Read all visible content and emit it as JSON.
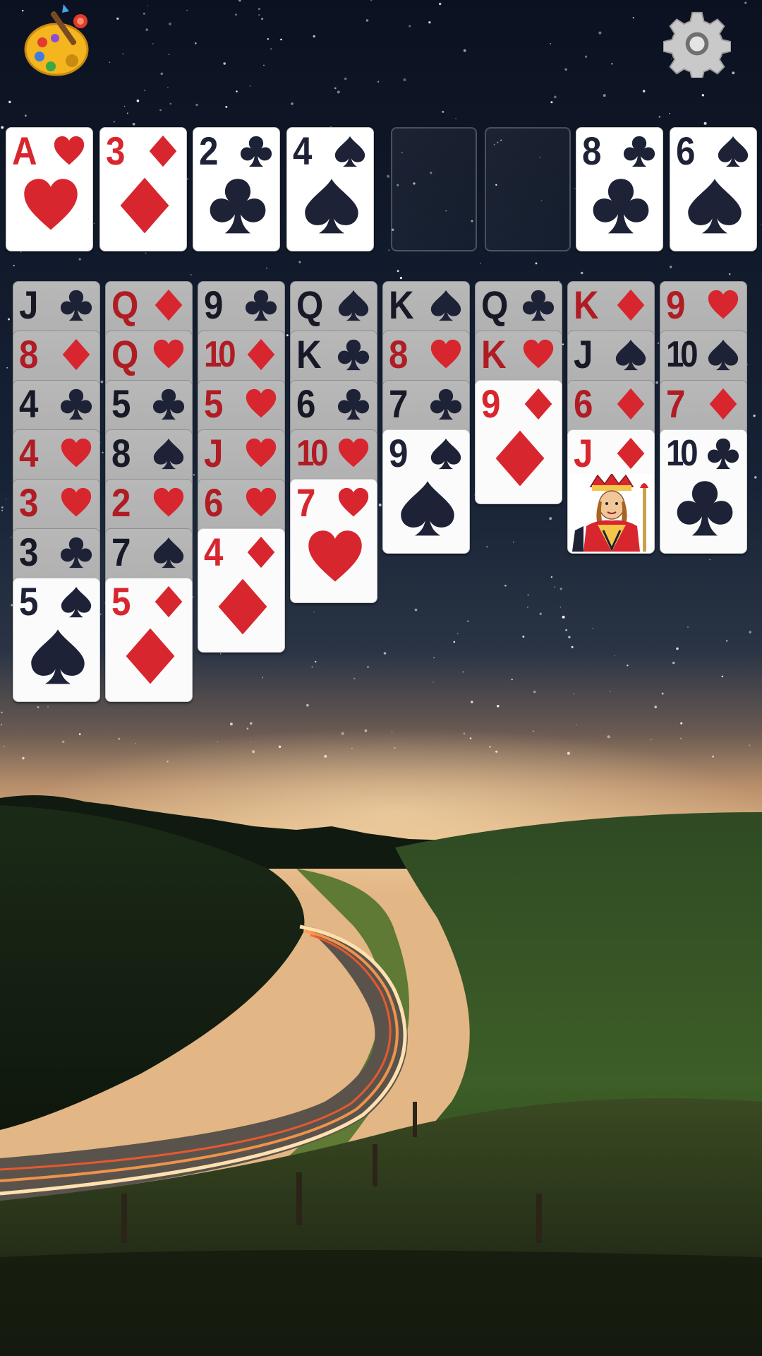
{
  "colors": {
    "red_suit": "#d8262f",
    "black_suit": "#1d2236",
    "card_face": "#ffffff",
    "covered_card": "#b0b0b0"
  },
  "toolbar": {
    "theme_icon": "palette-icon",
    "settings_icon": "gear-icon"
  },
  "foundations": [
    {
      "rank": "A",
      "suit": "hearts"
    },
    {
      "rank": "3",
      "suit": "diamonds"
    },
    {
      "rank": "2",
      "suit": "clubs"
    },
    {
      "rank": "4",
      "suit": "spades"
    }
  ],
  "free_cells": [
    {
      "empty": true
    },
    {
      "empty": true
    },
    {
      "rank": "8",
      "suit": "clubs"
    },
    {
      "rank": "6",
      "suit": "spades"
    }
  ],
  "tableau": [
    [
      {
        "rank": "J",
        "suit": "clubs"
      },
      {
        "rank": "8",
        "suit": "diamonds"
      },
      {
        "rank": "4",
        "suit": "clubs"
      },
      {
        "rank": "4",
        "suit": "hearts"
      },
      {
        "rank": "3",
        "suit": "hearts"
      },
      {
        "rank": "3",
        "suit": "clubs"
      },
      {
        "rank": "5",
        "suit": "spades"
      }
    ],
    [
      {
        "rank": "Q",
        "suit": "diamonds"
      },
      {
        "rank": "Q",
        "suit": "hearts"
      },
      {
        "rank": "5",
        "suit": "clubs"
      },
      {
        "rank": "8",
        "suit": "spades"
      },
      {
        "rank": "2",
        "suit": "hearts"
      },
      {
        "rank": "7",
        "suit": "spades"
      },
      {
        "rank": "5",
        "suit": "diamonds"
      }
    ],
    [
      {
        "rank": "9",
        "suit": "clubs"
      },
      {
        "rank": "10",
        "suit": "diamonds"
      },
      {
        "rank": "5",
        "suit": "hearts"
      },
      {
        "rank": "J",
        "suit": "hearts"
      },
      {
        "rank": "6",
        "suit": "hearts"
      },
      {
        "rank": "4",
        "suit": "diamonds"
      }
    ],
    [
      {
        "rank": "Q",
        "suit": "spades"
      },
      {
        "rank": "K",
        "suit": "clubs"
      },
      {
        "rank": "6",
        "suit": "clubs"
      },
      {
        "rank": "10",
        "suit": "hearts"
      },
      {
        "rank": "7",
        "suit": "hearts"
      }
    ],
    [
      {
        "rank": "K",
        "suit": "spades"
      },
      {
        "rank": "8",
        "suit": "hearts"
      },
      {
        "rank": "7",
        "suit": "clubs"
      },
      {
        "rank": "9",
        "suit": "spades"
      }
    ],
    [
      {
        "rank": "Q",
        "suit": "clubs"
      },
      {
        "rank": "K",
        "suit": "hearts"
      },
      {
        "rank": "9",
        "suit": "diamonds"
      }
    ],
    [
      {
        "rank": "K",
        "suit": "diamonds"
      },
      {
        "rank": "J",
        "suit": "spades"
      },
      {
        "rank": "6",
        "suit": "diamonds"
      },
      {
        "rank": "J",
        "suit": "diamonds"
      }
    ],
    [
      {
        "rank": "9",
        "suit": "hearts"
      },
      {
        "rank": "10",
        "suit": "spades"
      },
      {
        "rank": "7",
        "suit": "diamonds"
      },
      {
        "rank": "10",
        "suit": "clubs"
      }
    ]
  ]
}
